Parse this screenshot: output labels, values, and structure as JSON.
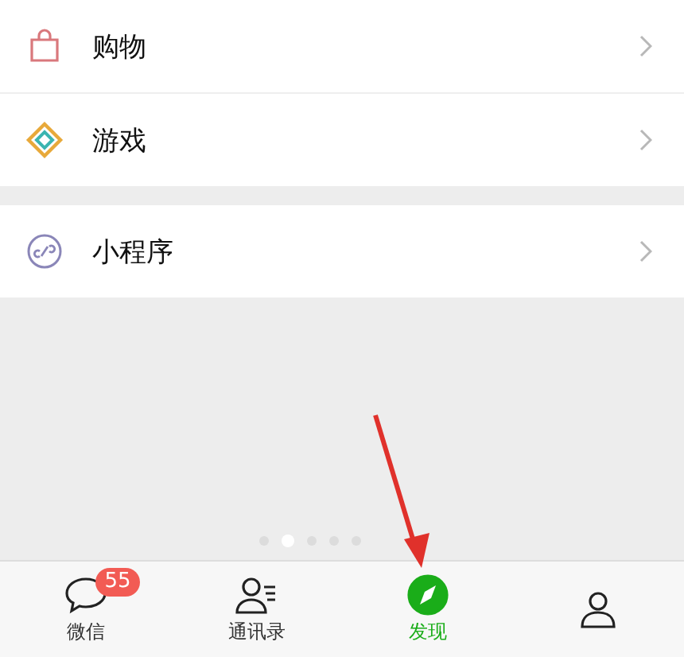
{
  "menu_groups": [
    {
      "items": [
        {
          "label": "购物",
          "kind": "bag"
        },
        {
          "label": "游戏",
          "kind": "diamond"
        }
      ]
    },
    {
      "items": [
        {
          "label": "小程序",
          "kind": "link"
        }
      ]
    }
  ],
  "page_dots": [
    {
      "selected": false
    },
    {
      "selected": true
    },
    {
      "selected": false
    },
    {
      "selected": false
    },
    {
      "selected": false
    }
  ],
  "tab_bar": [
    {
      "label": "微信",
      "kind": "chat",
      "badge": "55",
      "selected": false
    },
    {
      "label": "通讯录",
      "kind": "contacts",
      "selected": false
    },
    {
      "label": "发现",
      "kind": "compass",
      "selected": true
    },
    {
      "kind": "person",
      "selected": false
    }
  ]
}
